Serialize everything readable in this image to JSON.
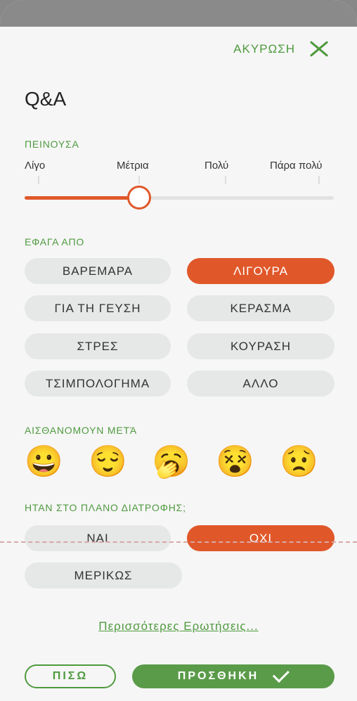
{
  "header": {
    "cancel_label": "ΑΚΥΡΩΣΗ",
    "title": "Q&A"
  },
  "hunger": {
    "label": "ΠΕΙΝΟΥΣΑ",
    "scale": [
      "Λίγο",
      "Μέτρια",
      "Πολύ",
      "Πάρα πολύ"
    ],
    "value_fraction": 0.37
  },
  "ate_from": {
    "label": "ΕΦΑΓΑ ΑΠΟ",
    "options": [
      "ΒΑΡΕΜΑΡΑ",
      "ΛΙΓΟΥΡΑ",
      "ΓΙΑ ΤΗ ΓΕΥΣΗ",
      "ΚΕΡΑΣΜΑ",
      "ΣΤΡΕΣ",
      "ΚΟΥΡΑΣΗ",
      "ΤΣΙΜΠΟΛΟΓΗΜΑ",
      "ΑΛΛΟ"
    ],
    "selected": "ΛΙΓΟΥΡΑ"
  },
  "feeling": {
    "label": "ΑΙΣΘΑΝΟΜΟΥΝ ΜΕΤΆ",
    "emojis": [
      "😀",
      "😌",
      "🥱",
      "😵",
      "😟"
    ],
    "emoji_names": [
      "grinning-face-icon",
      "relieved-face-icon",
      "yawning-face-icon",
      "dizzy-face-icon",
      "worried-face-icon"
    ]
  },
  "diet_plan": {
    "label": "ΗΤΑΝ ΣΤΟ ΠΛΑΝΟ ΔΙΑΤΡΟΦΗΣ;",
    "options": [
      "ΝΑΙ",
      "ΟΧΙ",
      "ΜΕΡΙΚΩΣ"
    ],
    "selected": "ΟΧΙ"
  },
  "more_questions": "Περισσότερες Ερωτήσεις...",
  "footer": {
    "back_label": "ΠΙΣΩ",
    "add_label": "ΠΡΟΣΘΗΚΗ"
  },
  "colors": {
    "accent": "#4f9a3f",
    "selected": "#e0582a",
    "pill": "#e6e7e7"
  }
}
